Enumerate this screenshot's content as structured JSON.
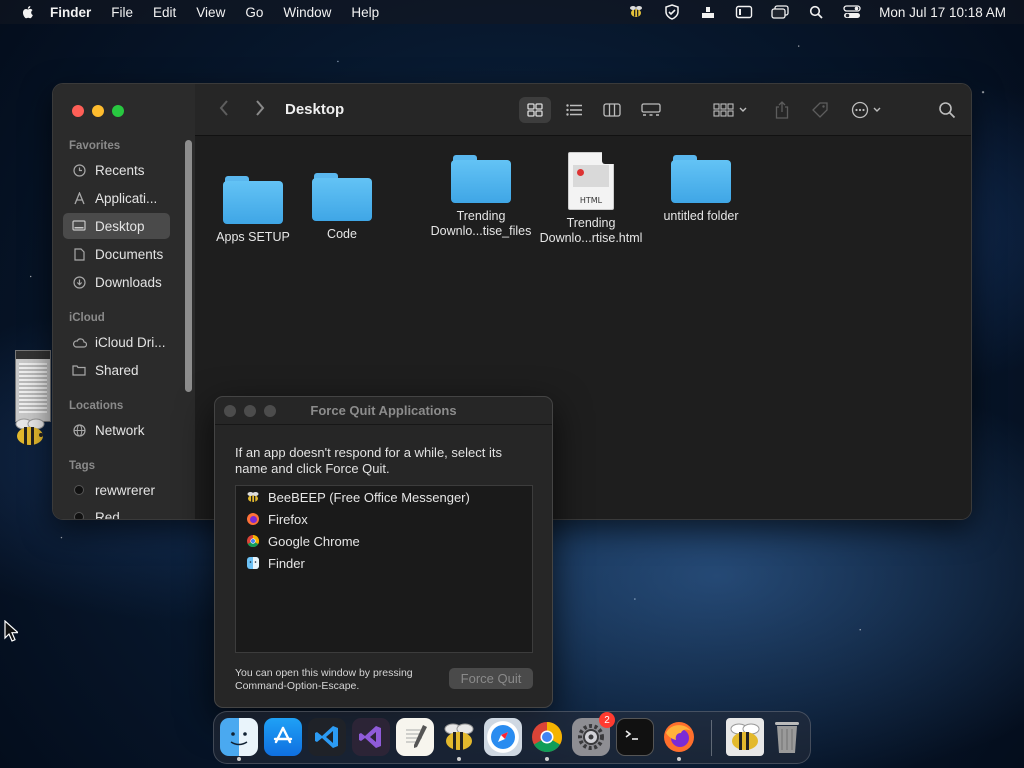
{
  "menubar": {
    "app": "Finder",
    "items": [
      "File",
      "Edit",
      "View",
      "Go",
      "Window",
      "Help"
    ],
    "clock": "Mon Jul 17  10:18 AM",
    "status_icons": [
      "beebeep-icon",
      "vpn-check-icon",
      "upload-tray-icon",
      "display-icon",
      "window-switch-icon",
      "spotlight-search-icon",
      "control-center-icon"
    ]
  },
  "finder": {
    "title": "Desktop",
    "sidebar": {
      "favorites_label": "Favorites",
      "favorites": [
        {
          "label": "Recents",
          "icon": "clock-icon"
        },
        {
          "label": "Applicati...",
          "icon": "applications-icon"
        },
        {
          "label": "Desktop",
          "icon": "desktop-icon",
          "active": true
        },
        {
          "label": "Documents",
          "icon": "document-icon"
        },
        {
          "label": "Downloads",
          "icon": "download-icon"
        }
      ],
      "icloud_label": "iCloud",
      "icloud": [
        {
          "label": "iCloud Dri...",
          "icon": "cloud-icon"
        },
        {
          "label": "Shared",
          "icon": "shared-folder-icon"
        }
      ],
      "locations_label": "Locations",
      "locations": [
        {
          "label": "Network",
          "icon": "globe-icon"
        }
      ],
      "tags_label": "Tags",
      "tags": [
        {
          "label": "rewwrerer",
          "color": "#111111"
        },
        {
          "label": "Red",
          "color": "#111111"
        }
      ]
    },
    "files": [
      {
        "name": "Apps SETUP",
        "kind": "folder"
      },
      {
        "name": "Code",
        "kind": "folder"
      },
      {
        "name": "Trending\nDownlo...tise_files",
        "name_line1": "Trending",
        "name_line2": "Downlo...tise_files",
        "kind": "folder"
      },
      {
        "name_line1": "Trending",
        "name_line2": "Downlo...rtise.html",
        "kind": "html",
        "badge": "HTML"
      },
      {
        "name": "untitled folder",
        "kind": "folder"
      }
    ]
  },
  "force_quit": {
    "title": "Force Quit Applications",
    "message": "If an app doesn't respond for a while, select its name and click Force Quit.",
    "apps": [
      {
        "name": "BeeBEEP (Free Office Messenger)",
        "icon": "bee-icon"
      },
      {
        "name": "Firefox",
        "icon": "firefox-icon"
      },
      {
        "name": "Google Chrome",
        "icon": "chrome-icon"
      },
      {
        "name": "Finder",
        "icon": "finder-icon"
      }
    ],
    "hint_line1": "You can open this window by pressing",
    "hint_line2": "Command-Option-Escape.",
    "button": "Force Quit"
  },
  "dock": {
    "apps": [
      {
        "name": "finder",
        "running": true
      },
      {
        "name": "app-store",
        "running": false
      },
      {
        "name": "vs-code",
        "running": false
      },
      {
        "name": "visual-studio",
        "running": false
      },
      {
        "name": "textedit",
        "running": false
      },
      {
        "name": "beebeep",
        "running": true
      },
      {
        "name": "safari",
        "running": false
      },
      {
        "name": "chrome",
        "running": true
      },
      {
        "name": "system-settings",
        "running": false,
        "badge": "2"
      },
      {
        "name": "terminal",
        "running": false
      },
      {
        "name": "firefox",
        "running": true
      },
      {
        "name": "beebeep-doc",
        "running": false
      },
      {
        "name": "trash",
        "running": false
      }
    ]
  },
  "colors": {
    "folder": "#4fb4ef",
    "traffic_red": "#fe5f57",
    "traffic_yellow": "#febc2e",
    "traffic_green": "#28c840",
    "badge": "#ff3b30"
  }
}
